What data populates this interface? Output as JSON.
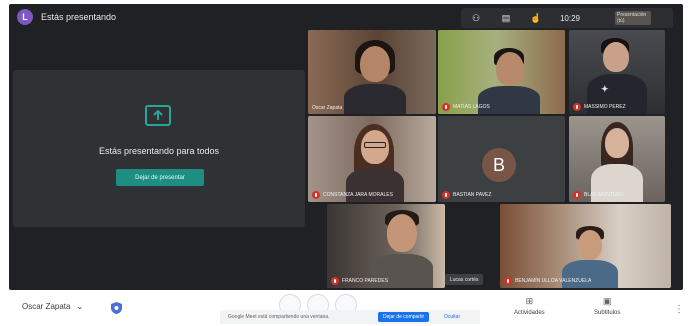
{
  "topbar": {
    "presenter_initial": "L",
    "presenter_status": "Estás presentando",
    "time": "10:29",
    "self_tile_label": "Presentación (tú)"
  },
  "presentation": {
    "title": "Estás presentando para todos",
    "stop_label": "Dejar de presentar"
  },
  "participants": [
    {
      "name": "Oscar Zapata"
    },
    {
      "name": "MATÍAS LAGOS"
    },
    {
      "name": "MASSIMO PEREZ"
    },
    {
      "name": "CONSTANZA JARA MORALES"
    },
    {
      "name": "BASTIAN PAVEZ",
      "initial": "B"
    },
    {
      "name": "BLAS MONTERO"
    },
    {
      "name": "FRANCO PAREDES"
    },
    {
      "name": "BENJAMÍN ULLOA VALENZUELA"
    }
  ],
  "tile_chip": "Lucas cortés",
  "bottombar": {
    "user": "Oscar Zapata",
    "notice": "Google Meet está compartiendo una ventana.",
    "notice_stop": "Dejar de compartir",
    "notice_hide": "Ocultar",
    "actions": [
      {
        "label": "Actividades",
        "icon": "activities-icon"
      },
      {
        "label": "Subtitulos",
        "icon": "captions-icon"
      }
    ]
  },
  "colors": {
    "call_bg": "#202124",
    "panel_bg": "#303134",
    "accent_teal": "#1e8e82",
    "mute_red": "#d93025"
  }
}
